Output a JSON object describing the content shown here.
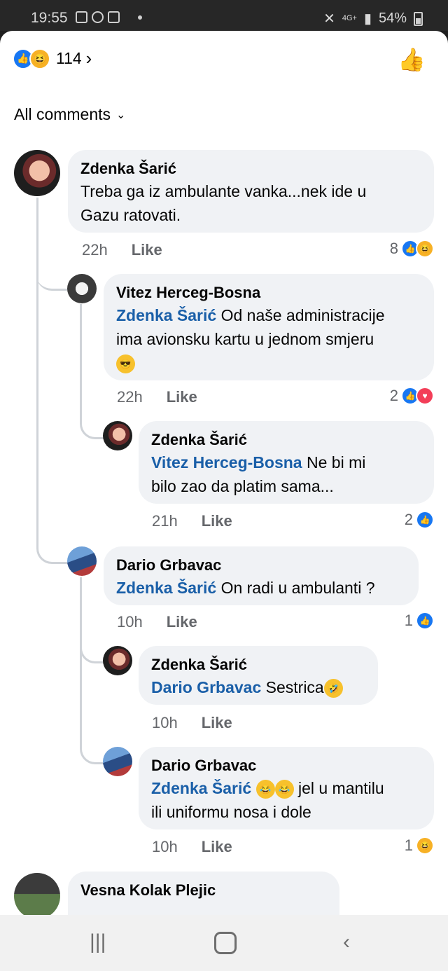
{
  "status_bar": {
    "time": "19:55",
    "network": "4G+",
    "battery": "54%"
  },
  "reactions_header": {
    "count": "114",
    "chevron": "›"
  },
  "filter": {
    "label": "All comments"
  },
  "comments": [
    {
      "name": "Zdenka Šarić",
      "mention": "",
      "line1": "Treba ga iz ambulante vanka...nek ide u",
      "line2": "Gazu ratovati.",
      "time": "22h",
      "like": "Like",
      "reactions": "8"
    },
    {
      "name": "Vitez Herceg-Bosna",
      "mention": "Zdenka Šarić",
      "line1": "Od naše administracije",
      "line2": "ima avionsku kartu u jednom smjeru",
      "time": "22h",
      "like": "Like",
      "reactions": "2"
    },
    {
      "name": "Zdenka Šarić",
      "mention": "Vitez Herceg-Bosna",
      "line1": "Ne bi mi",
      "line2": "bilo zao da platim sama...",
      "time": "21h",
      "like": "Like",
      "reactions": "2"
    },
    {
      "name": "Dario Grbavac",
      "mention": "Zdenka Šarić",
      "line1": "On radi u ambulanti ?",
      "line2": "",
      "time": "10h",
      "like": "Like",
      "reactions": "1"
    },
    {
      "name": "Zdenka Šarić",
      "mention": "Dario Grbavac",
      "line1": "Sestrica",
      "line2": "",
      "time": "10h",
      "like": "Like",
      "reactions": ""
    },
    {
      "name": "Dario Grbavac",
      "mention": "Zdenka Šarić",
      "line1": "jel u mantilu",
      "line2": "ili uniformu nosa i dole",
      "time": "10h",
      "like": "Like",
      "reactions": "1"
    },
    {
      "name": "Vesna Kolak Plejic",
      "mention": "",
      "line1": "",
      "line2": "",
      "time": "",
      "like": "",
      "reactions": ""
    }
  ],
  "icons": {
    "like": "like-icon",
    "haha": "haha-icon",
    "love": "love-icon",
    "cool": "sunglasses-emoji-icon"
  },
  "colors": {
    "like_blue": "#1877f2",
    "mention": "#1a5fa8",
    "bubble": "#f0f2f5"
  }
}
